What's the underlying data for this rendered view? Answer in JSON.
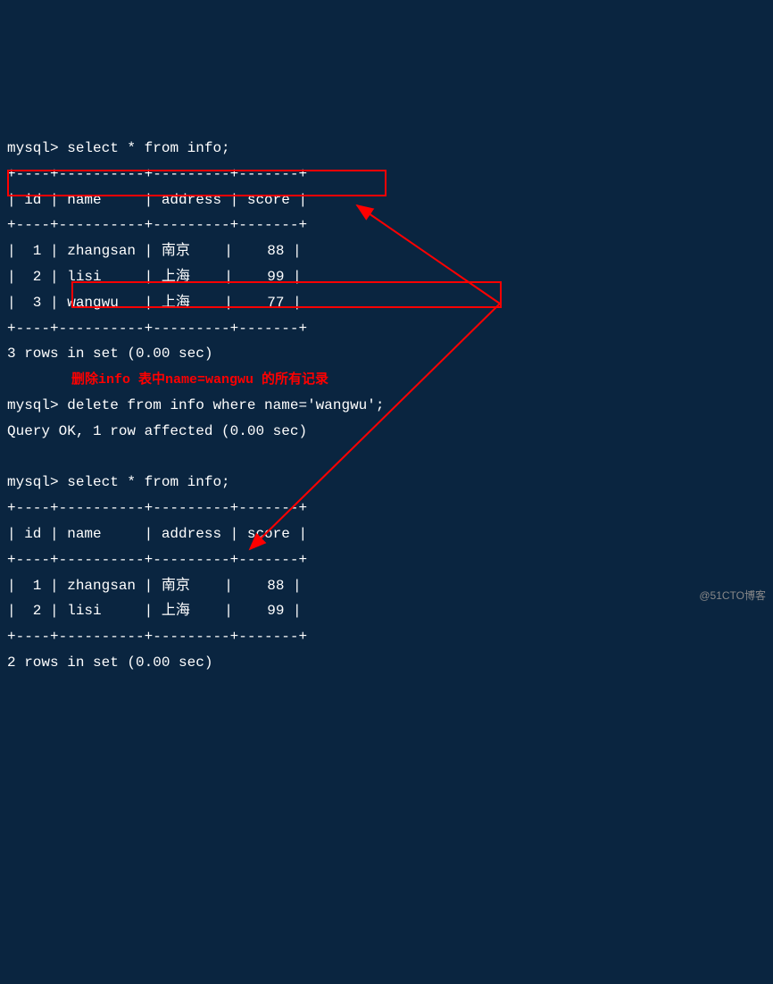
{
  "prompt": "mysql> ",
  "queries": {
    "select1": "select * from info;",
    "delete": "delete from info where name='wangwu';",
    "select2": "select * from info;"
  },
  "table1": {
    "separator": "+----+----------+---------+-------+",
    "header": "| id | name     | address | score |",
    "rows": [
      "|  1 | zhangsan | 南京    |    88 |",
      "|  2 | lisi     | 上海    |    99 |",
      "|  3 | wangwu   | 上海    |    77 |"
    ],
    "summary": "3 rows in set (0.00 sec)"
  },
  "annotation": "        删除info 表中name=wangwu 的所有记录",
  "delete_result": "Query OK, 1 row affected (0.00 sec)",
  "table2": {
    "separator": "+----+----------+---------+-------+",
    "header": "| id | name     | address | score |",
    "rows": [
      "|  1 | zhangsan | 南京    |    88 |",
      "|  2 | lisi     | 上海    |    99 |"
    ],
    "summary": "2 rows in set (0.00 sec)"
  },
  "watermark": "@51CTO博客",
  "chart_data": {
    "type": "table",
    "before": {
      "columns": [
        "id",
        "name",
        "address",
        "score"
      ],
      "rows": [
        [
          1,
          "zhangsan",
          "南京",
          88
        ],
        [
          2,
          "lisi",
          "上海",
          99
        ],
        [
          3,
          "wangwu",
          "上海",
          77
        ]
      ]
    },
    "after": {
      "columns": [
        "id",
        "name",
        "address",
        "score"
      ],
      "rows": [
        [
          1,
          "zhangsan",
          "南京",
          88
        ],
        [
          2,
          "lisi",
          "上海",
          99
        ]
      ]
    },
    "operation": "DELETE FROM info WHERE name='wangwu'"
  }
}
